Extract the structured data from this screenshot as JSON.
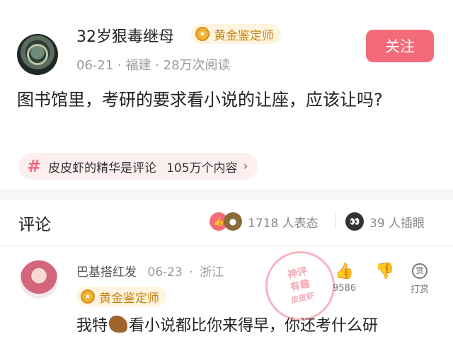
{
  "post": {
    "username": "32岁狠毒继母",
    "badge": "黄金鉴定师",
    "meta": "06-21 · 福建 · 28万次阅读",
    "follow_label": "关注",
    "title": "图书馆里，考研的要求看小说的让座，应该让吗?",
    "topic": {
      "label": "皮皮虾的精华是评论",
      "count": "105万个内容",
      "chevron": "›"
    }
  },
  "comments_section": {
    "title": "评论",
    "reaction1_label": "1718 人表态",
    "reaction2_label": "39 人插眼"
  },
  "comment": {
    "username": "巴基搭红发",
    "date": "06-23",
    "location": "浙江",
    "badge": "黄金鉴定师",
    "text_before": "我特",
    "text_after": "看小说都比你来得早，你还考什么研",
    "like_count": "9586",
    "tip_label": "打赏",
    "tip_icon_text": "赏"
  },
  "watermark": {
    "line1": "神评",
    "line2": "有趣",
    "line3": "皮皮虾"
  },
  "colors": {
    "accent": "#f36b7b",
    "badge_gold": "#c8830f"
  }
}
